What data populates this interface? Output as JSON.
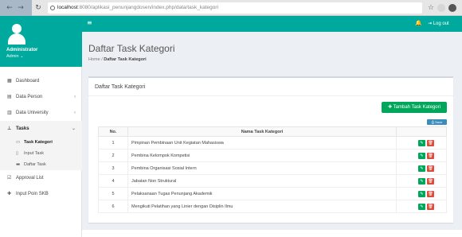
{
  "browser": {
    "url_host": "localhost",
    "url_path": ":8080/aplikasi_penunjangdosen/index.php/data/task_kategori",
    "back_icon": "arrow-left-icon",
    "forward_icon": "arrow-right-icon",
    "reload_icon": "reload-icon",
    "star_icon": "star-icon"
  },
  "sidebar": {
    "user_name": "Administrator",
    "user_role": "Admin ⌄",
    "items": [
      {
        "icon": "▦",
        "label": "Dashboard",
        "chev": ""
      },
      {
        "icon": "▤",
        "label": "Data Person",
        "chev": "‹"
      },
      {
        "icon": "▥",
        "label": "Data University",
        "chev": "‹"
      },
      {
        "icon": "⊥",
        "label": "Tasks",
        "chev": "⌄"
      }
    ],
    "subitems": [
      {
        "icon": "▭",
        "label": "Task Kategori"
      },
      {
        "icon": "▯",
        "label": "Input Task"
      },
      {
        "icon": "▬",
        "label": "Daftar Task"
      }
    ],
    "extra_items": [
      {
        "icon": "☑",
        "label": "Approval List"
      },
      {
        "icon": "✚",
        "label": "Input Poin SKB"
      }
    ]
  },
  "header": {
    "hamburger": "≡",
    "bell": "🔔",
    "logout": "⇥ Log out"
  },
  "page": {
    "title": "Daftar Task Kategori",
    "crumb_home": "Home",
    "crumb_sep": "/",
    "crumb_current": "Daftar Task Kategori"
  },
  "box": {
    "title": "Daftar Task Kategori",
    "add_button": "✚ Tambah Task Kategori",
    "print_button": "⎙ Save"
  },
  "table": {
    "headers": [
      "No.",
      "Nama Task Kategori",
      ""
    ],
    "rows": [
      {
        "no": "1",
        "name": "Pimpinan Pembinaan Unit Kegiatan Mahasiswa"
      },
      {
        "no": "2",
        "name": "Pembina Kelompok Kompetisi"
      },
      {
        "no": "3",
        "name": "Pembina Organisasi Sosial Intern"
      },
      {
        "no": "4",
        "name": "Jabatan Non Struktural"
      },
      {
        "no": "5",
        "name": "Pelaksanaan Tugas Penunjang Akademik"
      },
      {
        "no": "6",
        "name": "Mengikuti Pelatihan yang Linier dengan Disiplin Ilmu"
      }
    ],
    "edit_icon": "✎",
    "delete_icon": "🗑"
  },
  "colors": {
    "accent": "#00a99d",
    "add": "#00a65a",
    "delete": "#dd4b39",
    "print": "#3c8dbc"
  }
}
